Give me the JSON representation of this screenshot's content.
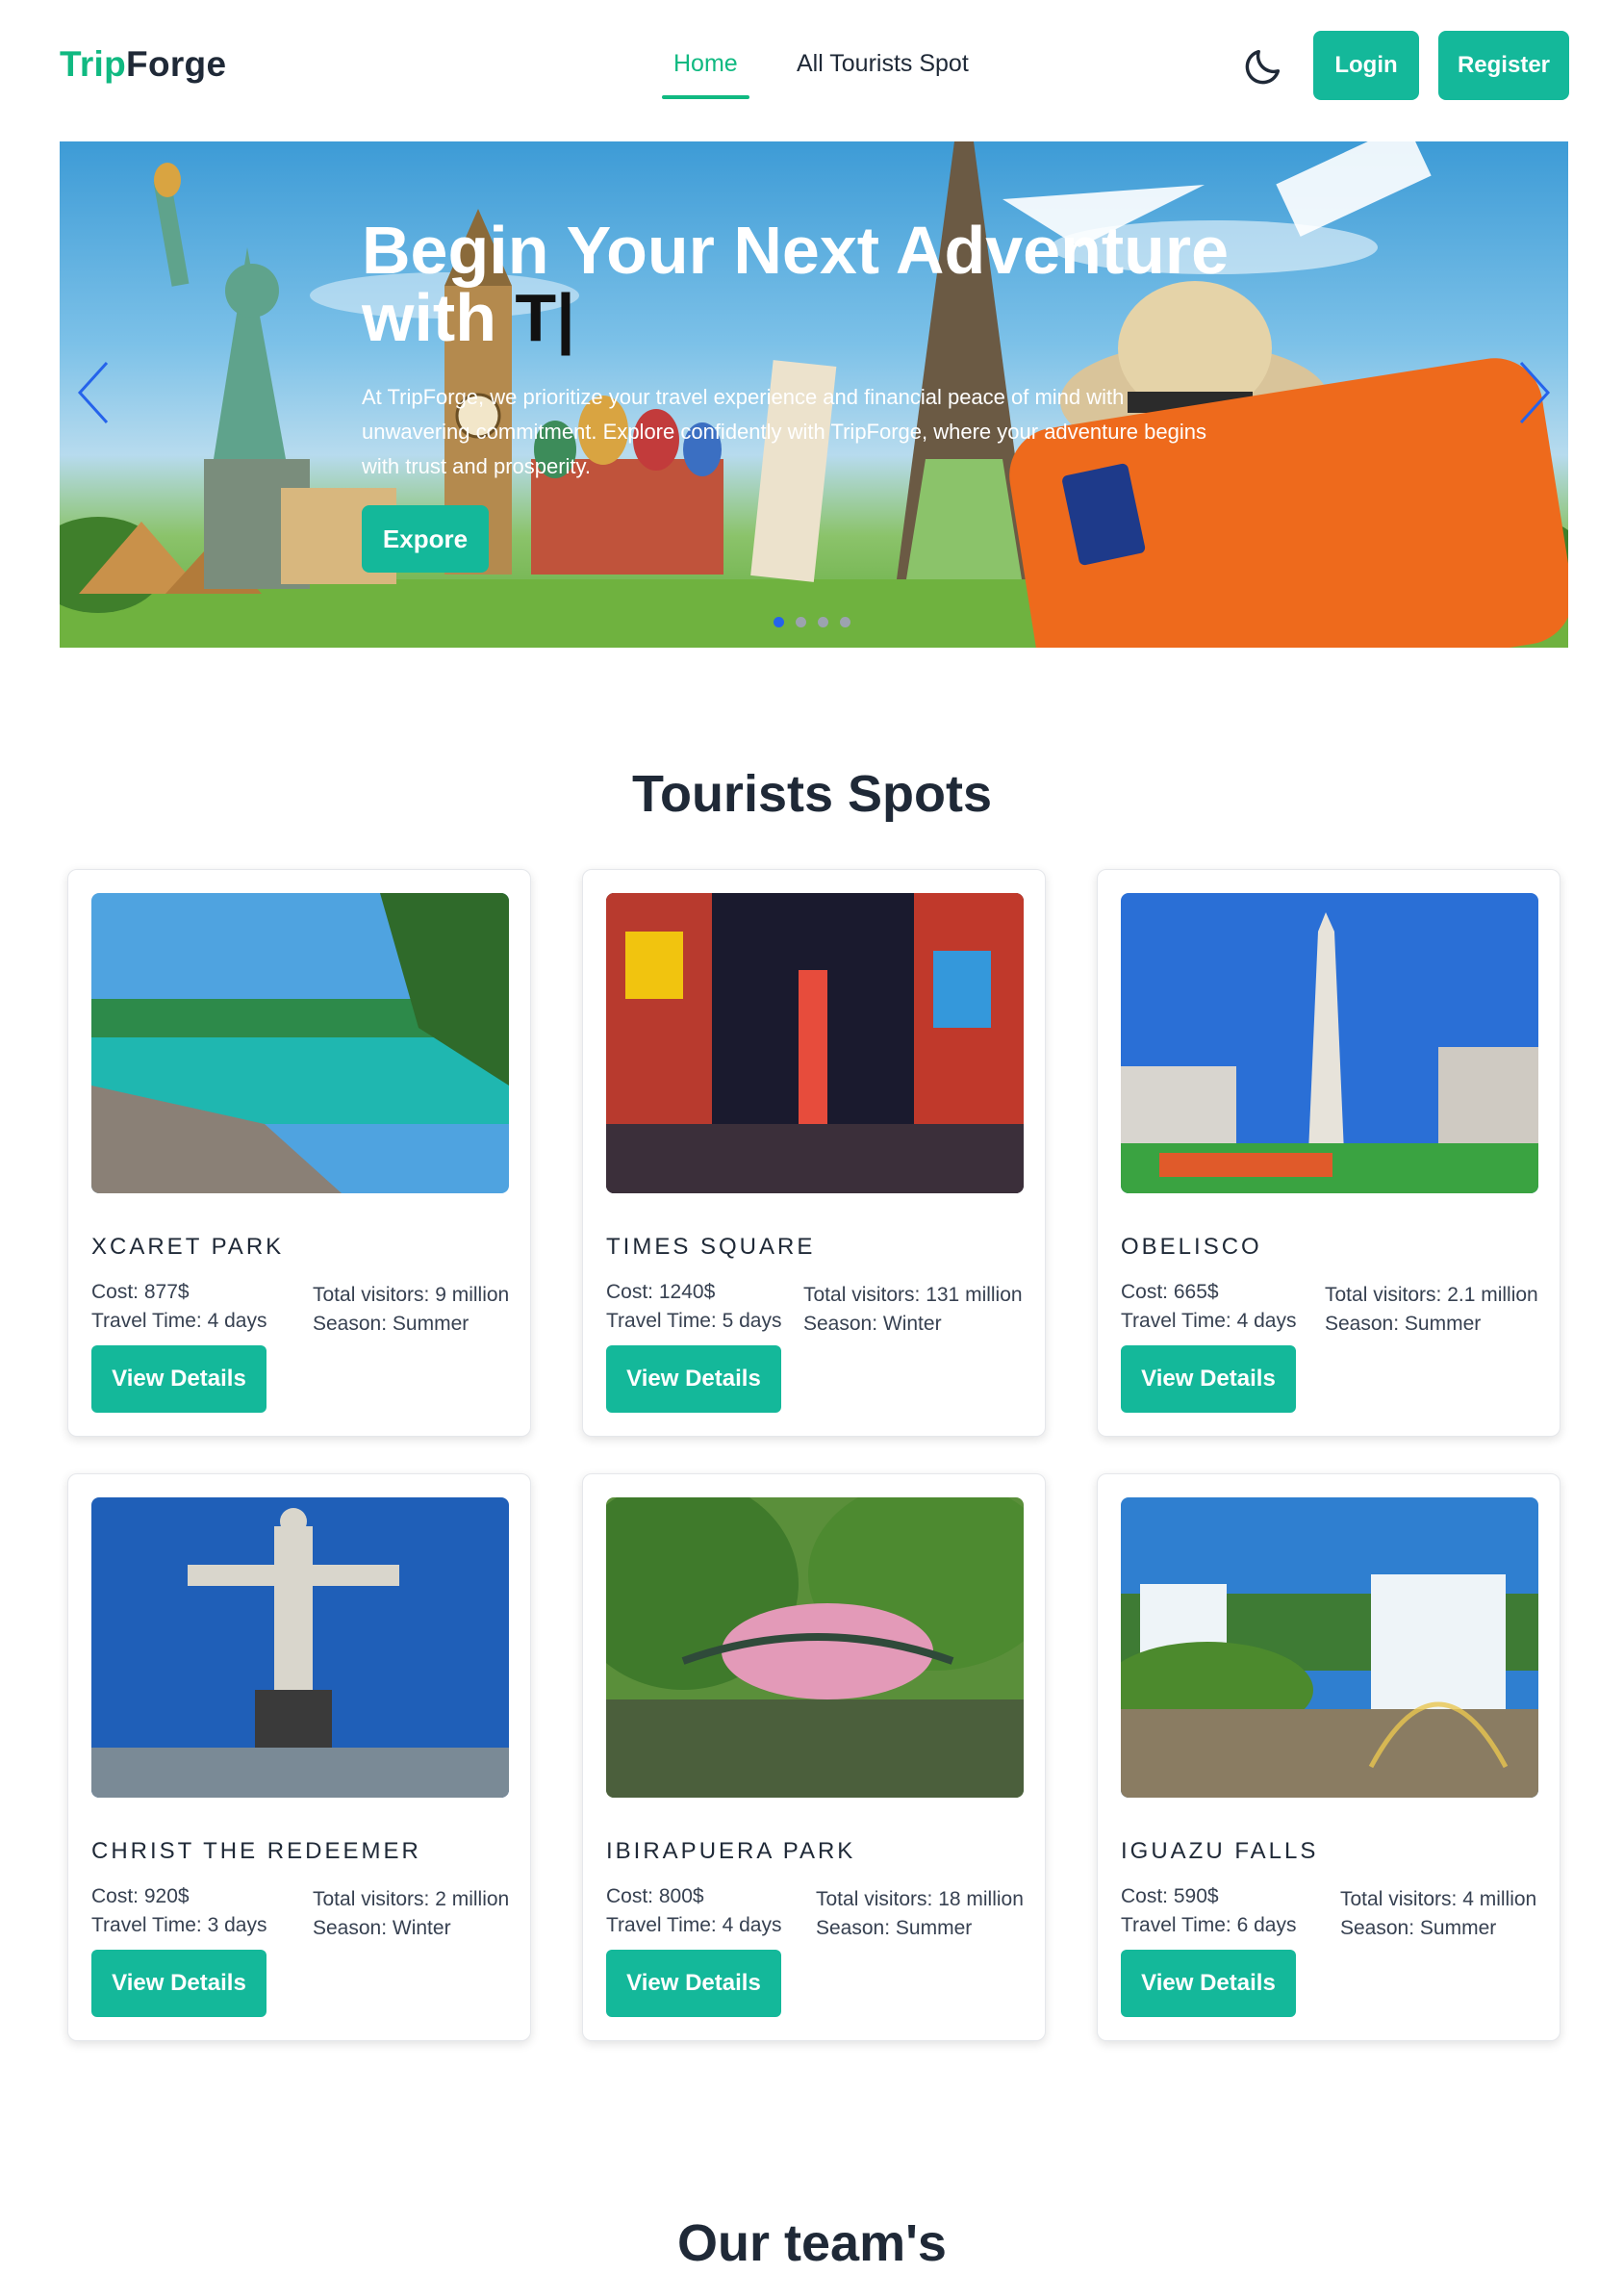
{
  "brand": {
    "part1": "Trip",
    "part2": "Forge"
  },
  "nav": {
    "home": "Home",
    "all_spots": "All Tourists Spot",
    "login": "Login",
    "register": "Register",
    "theme_icon": "moon-icon"
  },
  "hero": {
    "title_line1": "Begin Your Next Adventure",
    "title_line2": "with",
    "typed": "T|",
    "description": "At TripForge, we prioritize your travel experience and financial peace of mind with unwavering commitment. Explore confidently with TripForge, where your adventure begins with trust and prosperity.",
    "button": "Expore",
    "slides": 4,
    "active_slide": 1
  },
  "spots_section": {
    "title": "Tourists Spots"
  },
  "spots": [
    {
      "name": "XCARET PARK",
      "cost": "Cost: 877$",
      "time": "Travel Time: 4 days",
      "visitors": "Total visitors: 9 million",
      "season": "Season: Summer",
      "button": "View Details"
    },
    {
      "name": "TIMES SQUARE",
      "cost": "Cost: 1240$",
      "time": "Travel Time: 5 days",
      "visitors": "Total visitors: 131 million",
      "season": "Season: Winter",
      "button": "View Details"
    },
    {
      "name": "OBELISCO",
      "cost": "Cost: 665$",
      "time": "Travel Time: 4 days",
      "visitors": "Total visitors: 2.1 million",
      "season": "Season: Summer",
      "button": "View Details"
    },
    {
      "name": "CHRIST THE REDEEMER",
      "cost": "Cost: 920$",
      "time": "Travel Time: 3 days",
      "visitors": "Total visitors: 2 million",
      "season": "Season: Winter",
      "button": "View Details"
    },
    {
      "name": "IBIRAPUERA PARK",
      "cost": "Cost: 800$",
      "time": "Travel Time: 4 days",
      "visitors": "Total visitors: 18 million",
      "season": "Season: Summer",
      "button": "View Details"
    },
    {
      "name": "IGUAZU FALLS",
      "cost": "Cost: 590$",
      "time": "Travel Time: 6 days",
      "visitors": "Total visitors: 4 million",
      "season": "Season: Summer",
      "button": "View Details"
    }
  ],
  "team_section": {
    "title": "Our team's"
  }
}
